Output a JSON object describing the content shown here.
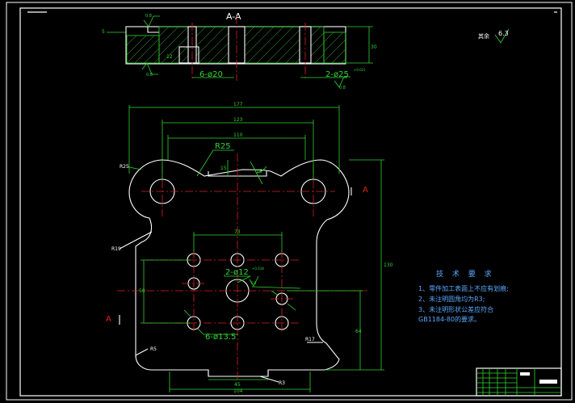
{
  "section": {
    "title": "A-A",
    "hole_label_left": "6-ø20",
    "hole_label_right": "2-ø25",
    "hole_label_right_tol": "+0.021",
    "dim_height": "30",
    "dim_left": "5",
    "dim_inner": "12",
    "rough_top": "0.8",
    "rough_bottom_left": "0.8",
    "rough_bottom_right": "0.8"
  },
  "roughness": {
    "label": "其余",
    "value": "6.3"
  },
  "plan": {
    "width_overall": "177",
    "width_mid": "123",
    "width_inner": "110",
    "radius_top": "R25",
    "radius_left": "R25",
    "radius_side": "R19",
    "radius_corner": "R5",
    "radius_bottom": "R17",
    "slot_depth": "15",
    "angle": "15",
    "hole_spacing": "73",
    "hole_pattern": "2-ø12",
    "hole_pattern_tol": "+0.018",
    "hole_pattern_rough": "0.8",
    "hole_small": "6-ø13.5",
    "height_overall": "130",
    "height_mid": "64",
    "dim_left_vertical": "50",
    "bottom_width_1": "45",
    "bottom_width_2": "104",
    "bottom_radius": "R3",
    "section_mark": "A"
  },
  "notes": {
    "title": "技 术 要 求",
    "items": [
      "1、零件加工表面上不应有划痕;",
      "2、未注明圆角均为R3;",
      "3、未注明形状公差应符合",
      "GB1184-80的要求。"
    ]
  },
  "title_block": {
    "marks": [
      "",
      "",
      ""
    ]
  }
}
